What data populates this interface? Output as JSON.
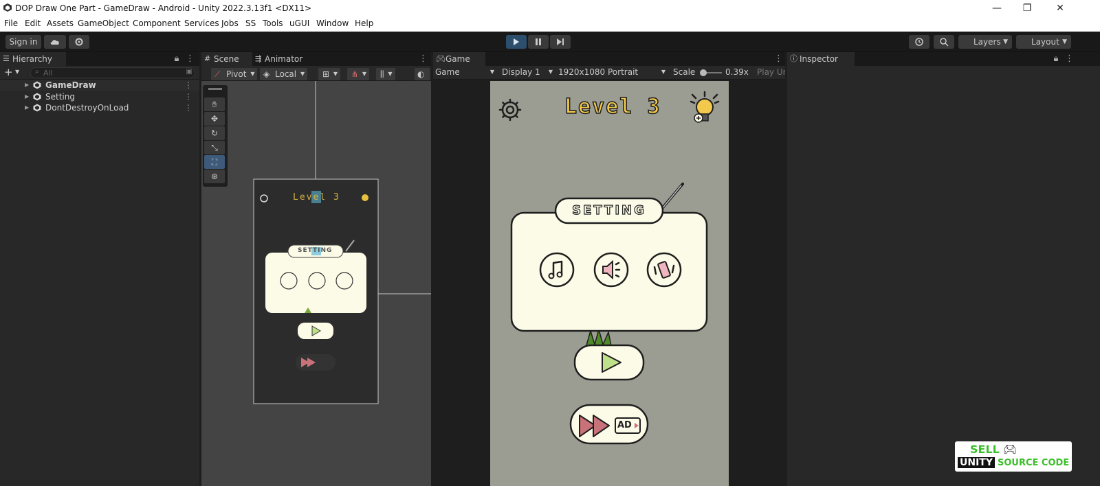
{
  "window": {
    "title": "DOP Draw One Part - GameDraw - Android - Unity 2022.3.13f1 <DX11>",
    "minimize": "—",
    "restore": "❐",
    "close": "✕"
  },
  "menu": [
    "File",
    "Edit",
    "Assets",
    "GameObject",
    "Component",
    "Services",
    "Jobs",
    "SS",
    "Tools",
    "uGUI",
    "Window",
    "Help"
  ],
  "toolbar": {
    "sign_in": "Sign in",
    "layers": "Layers",
    "layout": "Layout"
  },
  "hierarchy": {
    "tab": "Hierarchy",
    "add": "+",
    "search_placeholder": "All",
    "items": [
      {
        "label": "GameDraw"
      },
      {
        "label": "Setting"
      },
      {
        "label": "DontDestroyOnLoad"
      }
    ]
  },
  "scene": {
    "tab_scene": "Scene",
    "tab_animator": "Animator",
    "pivot": "Pivot",
    "local": "Local",
    "mini_title": "Level 3",
    "mini_setting": "SETTING"
  },
  "game": {
    "tab": "Game",
    "mode": "Game",
    "display": "Display 1",
    "resolution": "1920x1080 Portrait",
    "scale_label": "Scale",
    "scale_value": "0.39x",
    "play_unfocused": "Play Ur",
    "level_title": "Level 3",
    "setting_label": "SETTING",
    "ad_label": "AD"
  },
  "inspector": {
    "tab": "Inspector"
  },
  "watermark": {
    "line1": "SELL",
    "line2a": "UNITY",
    "line2b": "SOURCE CODE"
  },
  "colors": {
    "play_active": "#2d4f6e",
    "game_bg": "#9b9d92",
    "panel_cream": "#fcfbe8",
    "title_yellow": "#f2c94c",
    "play_green": "#bfe08a",
    "ff_red": "#c9727a",
    "watermark_green": "#3bbf2a"
  }
}
